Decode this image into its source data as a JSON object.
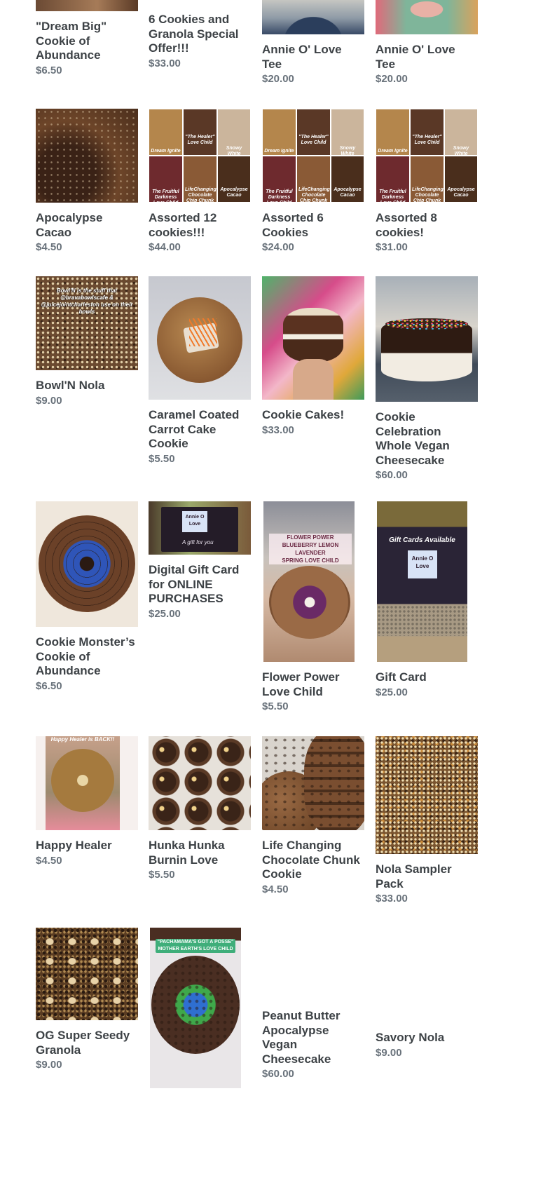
{
  "products": [
    {
      "title": "\"Dream Big\" Cookie of Abundance",
      "price": "$6.50",
      "image": "dream-big-cookie-photo"
    },
    {
      "title": "6 Cookies and Granola Special Offer!!!",
      "price": "$33.00",
      "image": "cookies-granola-photo"
    },
    {
      "title": "Annie O' Love Tee",
      "price": "$20.00",
      "image": "tee-model-photo"
    },
    {
      "title": "Annie O' Love Tee",
      "price": "$20.00",
      "image": "tee-print-photo"
    },
    {
      "title": "Apocalypse Cacao",
      "price": "$4.50",
      "image": "apocalypse-cacao-photo"
    },
    {
      "title": "Assorted 12 cookies!!!",
      "price": "$44.00",
      "image": "assorted-collage-photo"
    },
    {
      "title": "Assorted 6 Cookies",
      "price": "$24.00",
      "image": "assorted-collage-photo"
    },
    {
      "title": "Assorted 8 cookies!",
      "price": "$31.00",
      "image": "assorted-collage-photo"
    },
    {
      "title": "Bowl'N Nola",
      "price": "$9.00",
      "image": "bowl-n-nola-photo"
    },
    {
      "title": "Caramel Coated Carrot Cake Cookie",
      "price": "$5.50",
      "image": "carrot-cake-cookie-photo"
    },
    {
      "title": "Cookie Cakes!",
      "price": "$33.00",
      "image": "cookie-cake-photo"
    },
    {
      "title": "Cookie Celebration Whole Vegan Cheesecake",
      "price": "$60.00",
      "image": "celebration-cheesecake-photo"
    },
    {
      "title": "Cookie Monster’s Cookie of Abundance",
      "price": "$6.50",
      "image": "cookie-monster-photo"
    },
    {
      "title": "Digital Gift Card for ONLINE PURCHASES",
      "price": "$25.00",
      "image": "digital-gift-card-photo"
    },
    {
      "title": "Flower Power Love Child",
      "price": "$5.50",
      "image": "flower-power-photo"
    },
    {
      "title": "Gift Card",
      "price": "$25.00",
      "image": "gift-card-photo"
    },
    {
      "title": "Happy Healer",
      "price": "$4.50",
      "image": "happy-healer-photo"
    },
    {
      "title": "Hunka Hunka Burnin Love",
      "price": "$5.50",
      "image": "hunka-hunka-photo"
    },
    {
      "title": "Life Changing Chocolate Chunk Cookie",
      "price": "$4.50",
      "image": "life-changing-photo"
    },
    {
      "title": "Nola Sampler Pack",
      "price": "$33.00",
      "image": "nola-sampler-photo"
    },
    {
      "title": "OG Super Seedy Granola",
      "price": "$9.00",
      "image": "og-granola-photo"
    },
    {
      "title": "",
      "price": "",
      "image": "pachamama-cookie-photo"
    },
    {
      "title": "Peanut Butter Apocalypse Vegan Cheesecake",
      "price": "$60.00",
      "image": "none"
    },
    {
      "title": "Savory Nola",
      "price": "$9.00",
      "image": "none"
    }
  ],
  "image_text": {
    "collage": [
      "Dream Ignite",
      "\"The Healer\" Love Child",
      "Snowy White Apocalypse",
      "The Fruitful Darkness Love Child",
      "LifeChanging Chocolate Chip Chunk",
      "Apocalypse Cacao"
    ],
    "bowl": "Bowl'N is the stuff that @bravabowlscafe & @juicejointcharleston use on their bowls",
    "flower": [
      "FLOWER POWER",
      "BLUEBERRY LEMON LAVENDER",
      "SPRING LOVE CHILD"
    ],
    "gift_card": "Gift Cards Available",
    "happy": "Happy Healer is BACK!!",
    "pachamama": [
      "\"PACHAMAMA'S GOT A POSSE\"",
      "MOTHER EARTH'S LOVE CHILD"
    ],
    "card_logo": "Annie O Love",
    "card_script": "A gift for you"
  },
  "colors": {
    "title": "#3d4246",
    "price": "#69727b",
    "cookie_dark": "#4a2e1c",
    "cookie_mid": "#8a5a32",
    "granola": "#7a5530"
  }
}
